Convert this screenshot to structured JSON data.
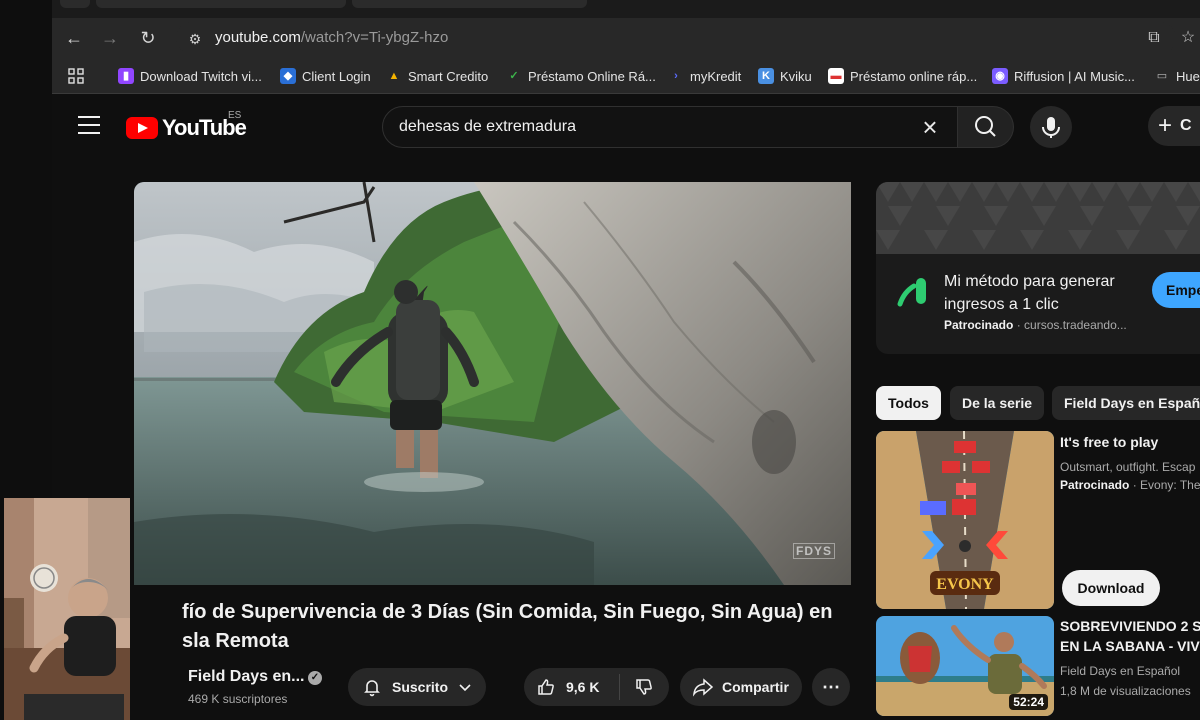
{
  "browser": {
    "url_host": "youtube.com",
    "url_path": "/watch?v=Ti-ybgZ-hzo",
    "bookmarks": [
      {
        "label": "Download Twitch vi...",
        "icon": "twitch-icon",
        "color": "#9146ff"
      },
      {
        "label": "Client Login",
        "icon": "client-login-icon",
        "color": "#2a6fd6"
      },
      {
        "label": "Smart Credito",
        "icon": "smart-credito-icon",
        "color": "#f5b400"
      },
      {
        "label": "Préstamo Online Rá...",
        "icon": "prestamo-icon",
        "color": "#3cb44b"
      },
      {
        "label": "myKredit",
        "icon": "mykredit-icon",
        "color": "#5b6cff"
      },
      {
        "label": "Kviku",
        "icon": "kviku-icon",
        "color": "#4a90e2"
      },
      {
        "label": "Préstamo online ráp...",
        "icon": "prestamo-rapido-icon",
        "color": "#d33"
      },
      {
        "label": "Riffusion | AI Music...",
        "icon": "riffusion-icon",
        "color": "#7b5cff"
      },
      {
        "label": "Hue",
        "icon": "folder-icon",
        "color": "#aaaaaa"
      }
    ]
  },
  "youtube": {
    "logo_text": "YouTube",
    "region": "ES",
    "search_query": "dehesas de extremadura",
    "create_label": "C"
  },
  "video": {
    "title_line1": "fío de Supervivencia de 3 Días (Sin Comida, Sin Fuego, Sin Agua) en",
    "title_line2": "sla Remota",
    "watermark": "FDYS",
    "channel": "Field Days en...",
    "subscribers": "469 K suscriptores",
    "subscribe_label": "Suscrito",
    "likes": "9,6 K",
    "share_label": "Compartir"
  },
  "sidebar": {
    "ad": {
      "title": "Mi método para generar ingresos a 1 clic",
      "sponsored": "Patrocinado",
      "domain": "· cursos.tradeando...",
      "cta": "Empe"
    },
    "chips": [
      "Todos",
      "De la serie",
      "Field Days en Españo"
    ],
    "recs": [
      {
        "title": "It's free to play",
        "line2": "Outsmart, outfight. Escap",
        "sponsored": "Patrocinado",
        "line3": "· Evony: The",
        "thumb_text": "EVONY",
        "button": "Download"
      },
      {
        "title_line1": "SOBREVIVIENDO 2 S",
        "title_line2": "EN LA SABANA - VIV",
        "channel": "Field Days en Español",
        "views": "1,8 M de visualizaciones",
        "duration": "52:24"
      }
    ]
  },
  "colors": {
    "yt_red": "#ff0000",
    "accent_blue": "#3ea6ff",
    "background": "#0f0f0f"
  }
}
